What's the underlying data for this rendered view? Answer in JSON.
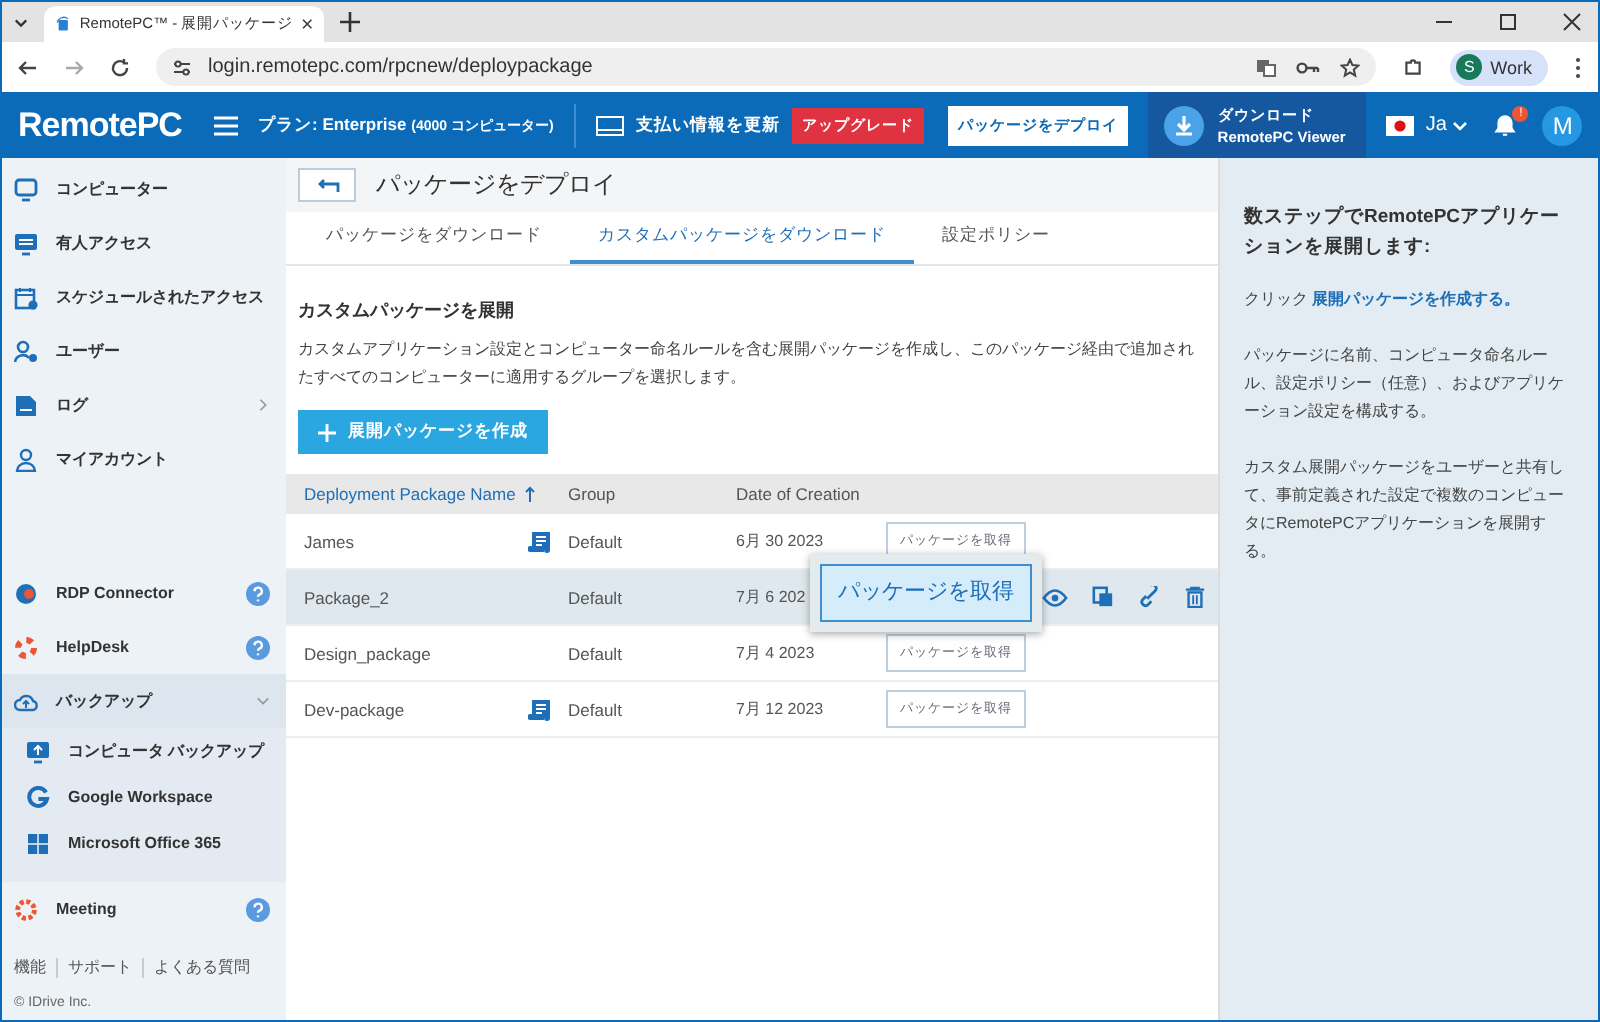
{
  "browser": {
    "tab_title": "RemotePC™ - 展開パッケージ",
    "url": "login.remotepc.com/rpcnew/deploypackage",
    "profile_initial": "S",
    "profile_label": "Work"
  },
  "header": {
    "logo": "RemotePC",
    "plan": "プラン: Enterprise",
    "plan_count": "(4000 コンピューター)",
    "billing": "支払い情報を更新",
    "upgrade": "アップグレード",
    "deploy": "パッケージをデプロイ",
    "download_line1": "ダウンロード",
    "download_line2": "RemotePC Viewer",
    "language": "Ja",
    "notification_badge": "!",
    "avatar": "M"
  },
  "sidebar": {
    "items": [
      {
        "label": "コンピューター"
      },
      {
        "label": "有人アクセス"
      },
      {
        "label": "スケジュールされたアクセス"
      },
      {
        "label": "ユーザー"
      },
      {
        "label": "ログ",
        "expandable": true,
        "expanded": false
      },
      {
        "label": "マイアカウント"
      }
    ],
    "apps": [
      {
        "kind": "app",
        "label": "RDP Connector"
      },
      {
        "kind": "app",
        "label": "HelpDesk"
      },
      {
        "kind": "group",
        "label": "バックアップ",
        "expanded": true,
        "children": [
          {
            "label": "コンピュータ バックアップ"
          },
          {
            "label": "Google Workspace"
          },
          {
            "label": "Microsoft Office 365"
          }
        ]
      },
      {
        "kind": "app",
        "label": "Meeting"
      }
    ],
    "footer_links": [
      "機能",
      "サポート",
      "よくある質問"
    ],
    "copyright": "© IDrive Inc."
  },
  "page": {
    "title": "パッケージをデプロイ",
    "tabs": [
      {
        "label": "パッケージをダウンロード",
        "selected": false
      },
      {
        "label": "カスタムパッケージをダウンロード",
        "selected": true
      },
      {
        "label": "設定ポリシー",
        "selected": false
      }
    ],
    "heading": "カスタムパッケージを展開",
    "description": "カスタムアプリケーション設定とコンピューター命名ルールを含む展開パッケージを作成し、このパッケージ経由で追加されたすべてのコンピューターに適用するグループを選択します。",
    "create_button": "展開パッケージを作成",
    "table": {
      "columns": [
        {
          "label": "Deployment Package Name",
          "sorted": true
        },
        {
          "label": "Group",
          "sorted": false
        },
        {
          "label": "Date of Creation",
          "sorted": false
        }
      ],
      "rows": [
        {
          "name": "James",
          "note": true,
          "group": "Default",
          "date": "6月 30 2023",
          "button": "パッケージを取得",
          "selected": false
        },
        {
          "name": "Package_2",
          "note": false,
          "group": "Default",
          "date": "7月 6 202",
          "selected": true
        },
        {
          "name": "Design_package",
          "note": false,
          "group": "Default",
          "date": "7月 4 2023",
          "button": "パッケージを取得",
          "selected": false
        },
        {
          "name": "Dev-package",
          "note": true,
          "group": "Default",
          "date": "7月 12 2023",
          "button": "パッケージを取得",
          "selected": false
        }
      ],
      "tooltip": "パッケージを取得"
    }
  },
  "help_panel": {
    "heading": "数ステップでRemotePCアプリケーションを展開します:",
    "click_prefix": "クリック",
    "click_link": "展開パッケージを作成する。",
    "paragraphs": [
      "パッケージに名前、コンピュータ命名ルール、設定ポリシー（任意）、およびアプリケーション設定を構成する。",
      "カスタム展開パッケージをユーザーと共有して、事前定義された設定で複数のコンピュータにRemotePCアプリケーションを展開する。"
    ]
  }
}
